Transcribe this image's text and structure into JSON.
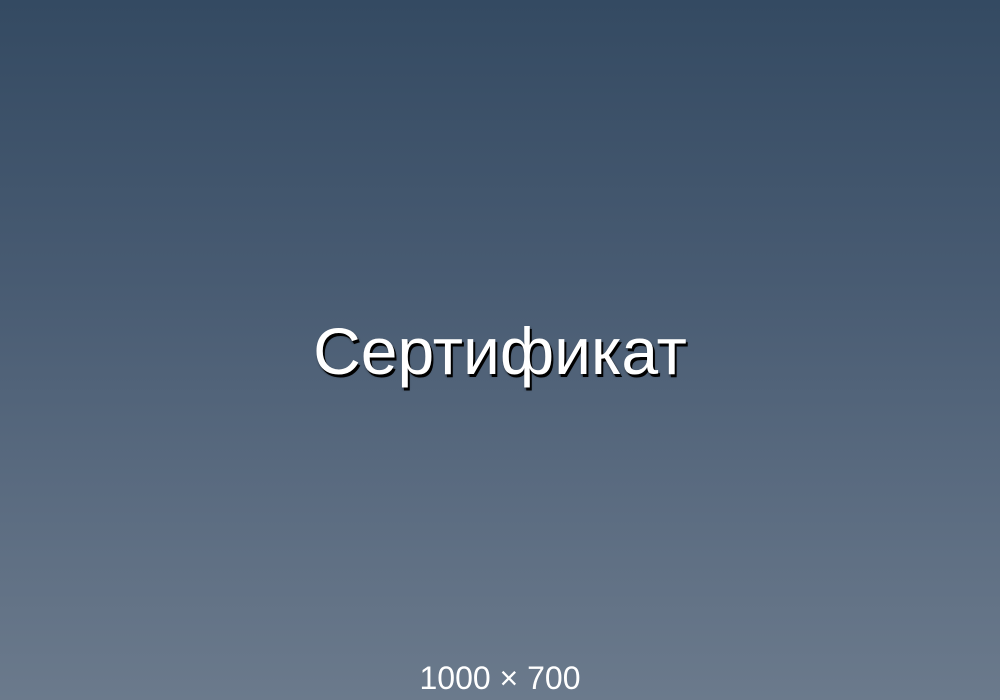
{
  "image": {
    "title": "Сертификат",
    "dimensions_label": "1000 × 700"
  },
  "colors": {
    "background_top": "#344a62",
    "background_bottom": "#6b7a8c",
    "text": "#ffffff",
    "text_shadow": "#000000"
  }
}
